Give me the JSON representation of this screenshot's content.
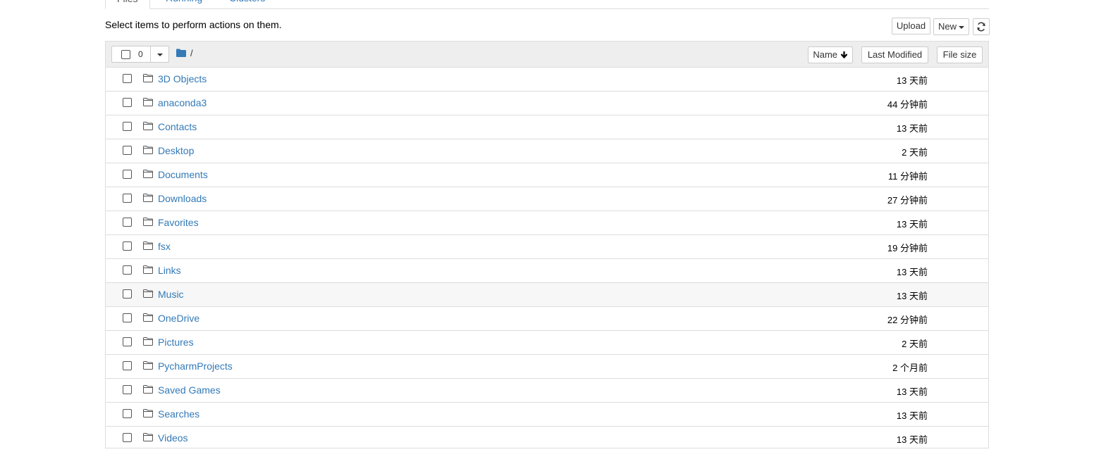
{
  "tabs": [
    {
      "label": "Files",
      "active": true
    },
    {
      "label": "Running",
      "active": false
    },
    {
      "label": "Clusters",
      "active": false
    }
  ],
  "toolbar": {
    "instructions": "Select items to perform actions on them.",
    "upload_label": "Upload",
    "new_label": "New",
    "refresh_icon": "refresh-icon"
  },
  "list_header": {
    "selected_count": "0",
    "breadcrumb_icon": "folder-icon",
    "breadcrumb_path": "/",
    "sort_name_label": "Name",
    "sort_name_icon": "arrow-down-icon",
    "sort_modified_label": "Last Modified",
    "sort_size_label": "File size"
  },
  "items": [
    {
      "name": "3D Objects",
      "modified": "13 天前"
    },
    {
      "name": "anaconda3",
      "modified": "44 分钟前"
    },
    {
      "name": "Contacts",
      "modified": "13 天前"
    },
    {
      "name": "Desktop",
      "modified": "2 天前"
    },
    {
      "name": "Documents",
      "modified": "11 分钟前"
    },
    {
      "name": "Downloads",
      "modified": "27 分钟前"
    },
    {
      "name": "Favorites",
      "modified": "13 天前"
    },
    {
      "name": "fsx",
      "modified": "19 分钟前"
    },
    {
      "name": "Links",
      "modified": "13 天前"
    },
    {
      "name": "Music",
      "modified": "13 天前",
      "hovered": true
    },
    {
      "name": "OneDrive",
      "modified": "22 分钟前"
    },
    {
      "name": "Pictures",
      "modified": "2 天前"
    },
    {
      "name": "PycharmProjects",
      "modified": "2 个月前"
    },
    {
      "name": "Saved Games",
      "modified": "13 天前"
    },
    {
      "name": "Searches",
      "modified": "13 天前"
    },
    {
      "name": "Videos",
      "modified": "13 天前"
    }
  ],
  "colors": {
    "link": "#337ab7",
    "header_bg": "#eeeeee",
    "border": "#dddddd",
    "breadcrumb_icon": "#337ab7"
  }
}
